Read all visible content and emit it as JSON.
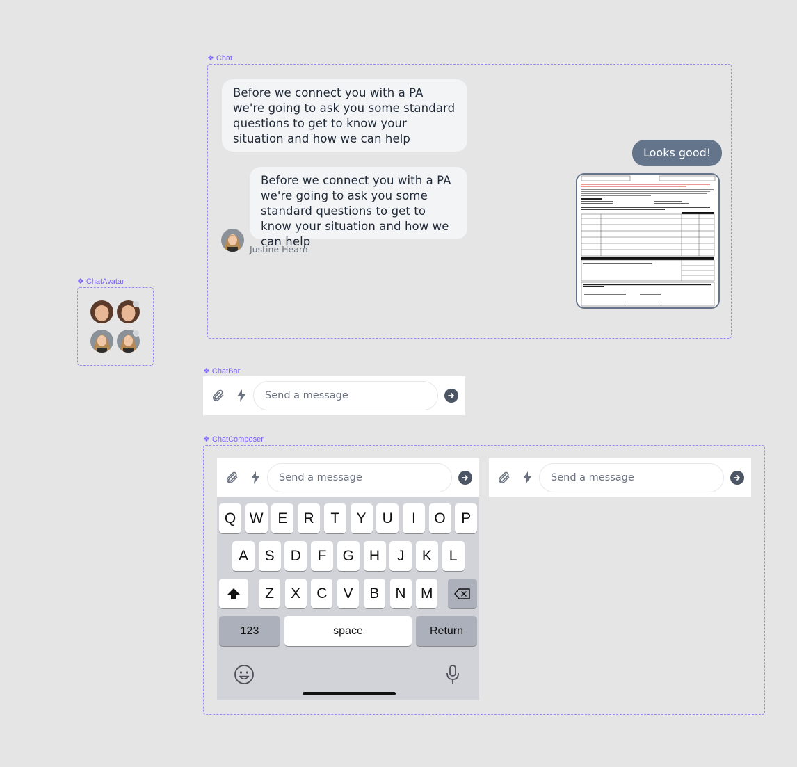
{
  "frames": {
    "chat": "Chat",
    "chat_avatar": "ChatAvatar",
    "chat_bar": "ChatBar",
    "chat_composer": "ChatComposer"
  },
  "chat": {
    "message_1": "Before we connect you with a PA we're going to ask you some standard questions to get to know your situation and how we can help",
    "message_2": "Before we connect you with a PA we're going to ask you some standard questions to get to know your situation and how we can help",
    "sender_name": "Justine Hearn",
    "reply": "Looks good!",
    "attachment_icon": "document-preview"
  },
  "composer": {
    "placeholder": "Send a message",
    "attach_icon": "paperclip-icon",
    "quick_icon": "lightning-icon",
    "send_icon": "arrow-right-icon"
  },
  "keyboard": {
    "row1": [
      "Q",
      "W",
      "E",
      "R",
      "T",
      "Y",
      "U",
      "I",
      "O",
      "P"
    ],
    "row2": [
      "A",
      "S",
      "D",
      "F",
      "G",
      "H",
      "J",
      "K",
      "L"
    ],
    "row3": [
      "Z",
      "X",
      "C",
      "V",
      "B",
      "N",
      "M"
    ],
    "numbers_label": "123",
    "space_label": "space",
    "return_label": "Return"
  },
  "colors": {
    "accent": "#7b61ff",
    "bubble_out": "#64748b",
    "bubble_in": "#f3f4f6"
  }
}
